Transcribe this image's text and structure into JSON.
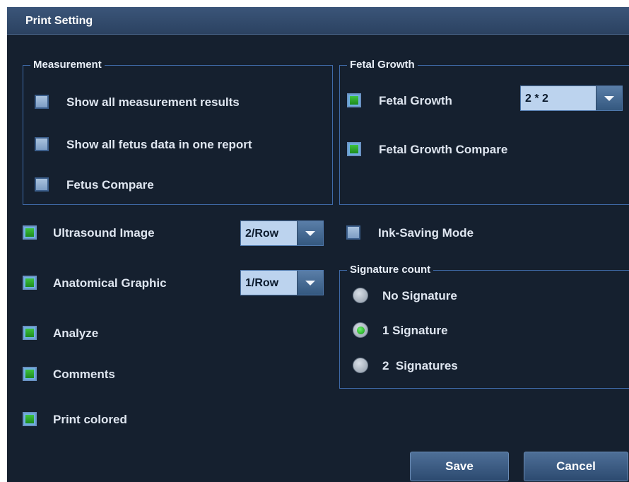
{
  "dialog": {
    "title": "Print Setting"
  },
  "measurement": {
    "legend": "Measurement",
    "items": [
      {
        "label": "Show all measurement results",
        "checked": false
      },
      {
        "label": "Show all fetus data in one report",
        "checked": false
      },
      {
        "label": "Fetus Compare",
        "checked": false
      }
    ]
  },
  "fetal_growth": {
    "legend": "Fetal Growth",
    "fetal_growth_label": "Fetal Growth",
    "fetal_growth_checked": true,
    "layout_value": "2 * 2",
    "compare_label": "Fetal Growth Compare",
    "compare_checked": true
  },
  "options": {
    "ultrasound_image": {
      "label": "Ultrasound Image",
      "checked": true,
      "value": "2/Row"
    },
    "anatomical_graphic": {
      "label": "Anatomical Graphic",
      "checked": true,
      "value": "1/Row"
    },
    "analyze": {
      "label": "Analyze",
      "checked": true
    },
    "comments": {
      "label": "Comments",
      "checked": true
    },
    "print_colored": {
      "label": "Print colored",
      "checked": true
    },
    "ink_saving": {
      "label": "Ink-Saving Mode",
      "checked": false
    }
  },
  "signature": {
    "legend": "Signature count",
    "options": [
      {
        "label": "No Signature",
        "selected": false
      },
      {
        "label": "1 Signature",
        "selected": true
      },
      {
        "label": "2  Signatures",
        "selected": false
      }
    ]
  },
  "buttons": {
    "save": "Save",
    "cancel": "Cancel"
  },
  "colors": {
    "background": "#15202f",
    "border": "#3f6aa8",
    "check_green": "#2aa52a",
    "title_bar": "#33496a"
  }
}
